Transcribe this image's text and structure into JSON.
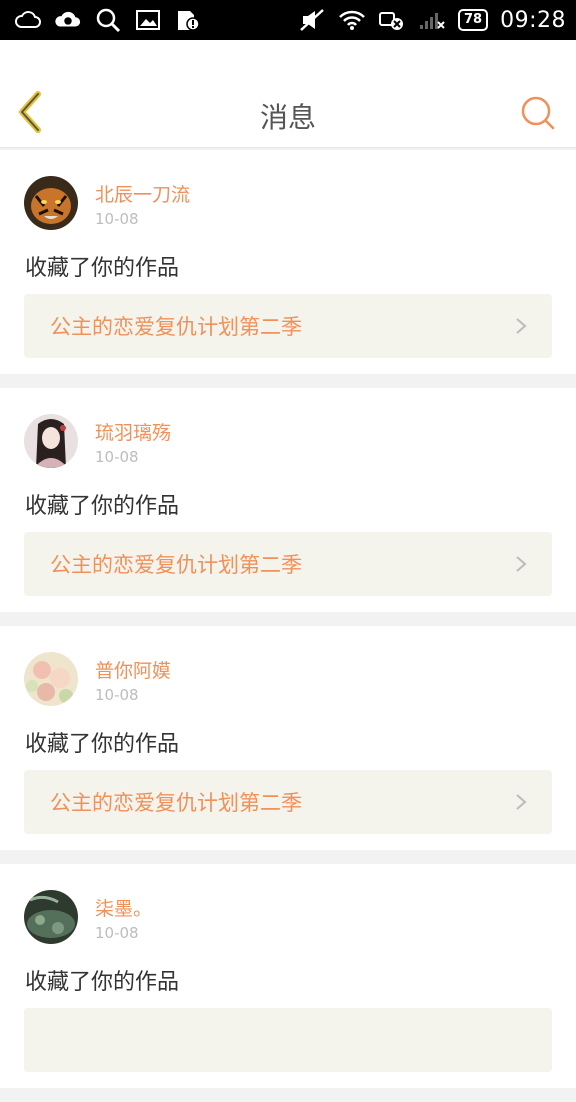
{
  "status_bar": {
    "time": "09:28",
    "battery": "78",
    "left_icons": [
      "weather-icon",
      "cloud-icon",
      "search-icon",
      "image-icon",
      "sim-alert-icon"
    ],
    "right_icons": [
      "mute-icon",
      "wifi-icon",
      "data-off-icon",
      "signal-icon"
    ]
  },
  "header": {
    "title": "消息",
    "accent": "#f0915a",
    "back_color": "#e6c22a"
  },
  "messages": [
    {
      "user": "北辰一刀流",
      "date": "10-08",
      "action": "收藏了你的作品",
      "work": "公主的恋爱复仇计划第二季",
      "avatar": "tiger"
    },
    {
      "user": "琉羽璃殇",
      "date": "10-08",
      "action": "收藏了你的作品",
      "work": "公主的恋爱复仇计划第二季",
      "avatar": "girl"
    },
    {
      "user": "普你阿嫫",
      "date": "10-08",
      "action": "收藏了你的作品",
      "work": "公主的恋爱复仇计划第二季",
      "avatar": "flowers"
    },
    {
      "user": "柒墨。",
      "date": "10-08",
      "action": "收藏了你的作品",
      "work": "",
      "avatar": "pond"
    }
  ]
}
